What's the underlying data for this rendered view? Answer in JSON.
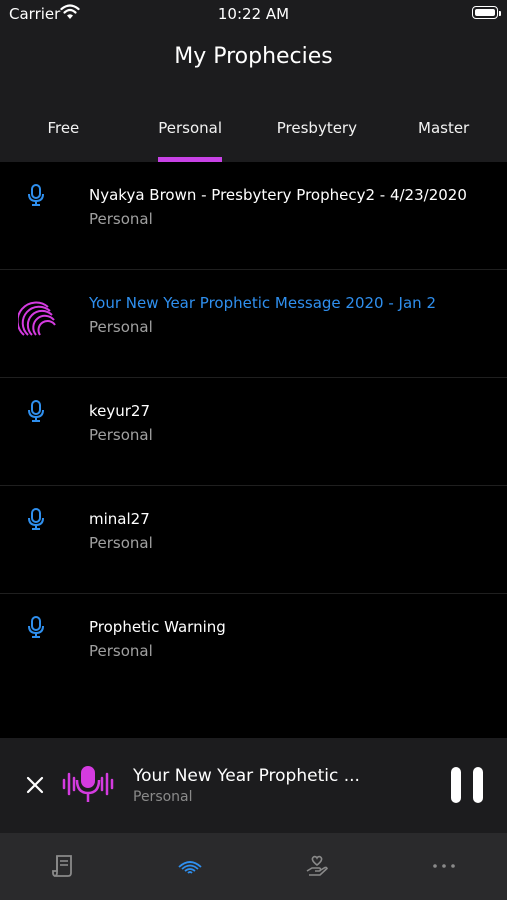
{
  "status": {
    "carrier": "Carrier",
    "time": "10:22 AM"
  },
  "header": {
    "title": "My Prophecies"
  },
  "tabs": [
    {
      "label": "Free",
      "active": false
    },
    {
      "label": "Personal",
      "active": true
    },
    {
      "label": "Presbytery",
      "active": false
    },
    {
      "label": "Master",
      "active": false
    }
  ],
  "list": [
    {
      "title": "Nyakya Brown - Presbytery Prophecy2 - 4/23/2020",
      "subtitle": "Personal",
      "icon": "microphone-icon"
    },
    {
      "title": "Your New Year Prophetic Message 2020 - Jan 2",
      "subtitle": "Personal",
      "icon": "playing-signal-icon"
    },
    {
      "title": "keyur27",
      "subtitle": "Personal",
      "icon": "microphone-icon"
    },
    {
      "title": "minal27",
      "subtitle": "Personal",
      "icon": "microphone-icon"
    },
    {
      "title": "Prophetic Warning",
      "subtitle": "Personal",
      "icon": "microphone-icon"
    }
  ],
  "player": {
    "title": "Your New Year Prophetic ...",
    "subtitle": "Personal"
  },
  "tabbar": [
    {
      "icon": "scroll-icon"
    },
    {
      "icon": "waves-icon",
      "active": true
    },
    {
      "icon": "heart-hand-icon"
    },
    {
      "icon": "more-icon"
    }
  ],
  "colors": {
    "accent_pink": "#c842e6",
    "accent_blue": "#2f8fee",
    "magenta": "#d43be0"
  }
}
